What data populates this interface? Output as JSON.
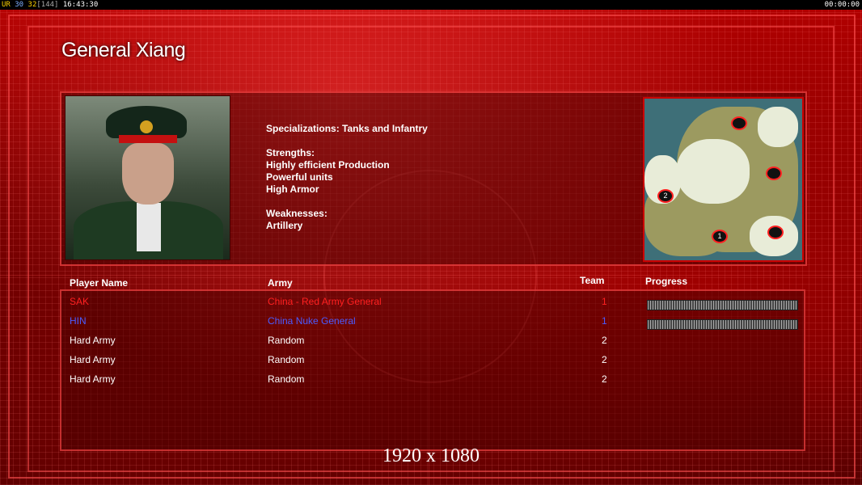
{
  "topbar": {
    "ur": "UR",
    "fps": "30",
    "frames": "32",
    "bracket": "[144]",
    "clock": "16:43:30",
    "timer": "00:00:00"
  },
  "general": {
    "title": "General Xiang",
    "specializations": "Specializations: Tanks and Infantry",
    "strengths_label": "Strengths:",
    "strengths": [
      "Highly efficient Production",
      "Powerful units",
      "High Armor"
    ],
    "weaknesses_label": "Weaknesses:",
    "weaknesses": [
      "Artillery"
    ]
  },
  "minimap": {
    "spawn_labels": [
      "",
      "",
      "2",
      "1",
      ""
    ]
  },
  "table": {
    "headers": {
      "player": "Player Name",
      "army": "Army",
      "team": "Team",
      "progress": "Progress"
    },
    "rows": [
      {
        "name": "SAK",
        "army": "China - Red Army General",
        "team": "1",
        "color": "#ff2020",
        "progress": 1.0
      },
      {
        "name": "HIN",
        "army": "China Nuke General",
        "team": "1",
        "color": "#4a5cff",
        "progress": 1.0
      },
      {
        "name": "Hard Army",
        "army": "Random",
        "team": "2",
        "color": "#ffffff"
      },
      {
        "name": "Hard Army",
        "army": "Random",
        "team": "2",
        "color": "#ffffff"
      },
      {
        "name": "Hard Army",
        "army": "Random",
        "team": "2",
        "color": "#ffffff"
      }
    ]
  },
  "resolution": "1920 x 1080"
}
